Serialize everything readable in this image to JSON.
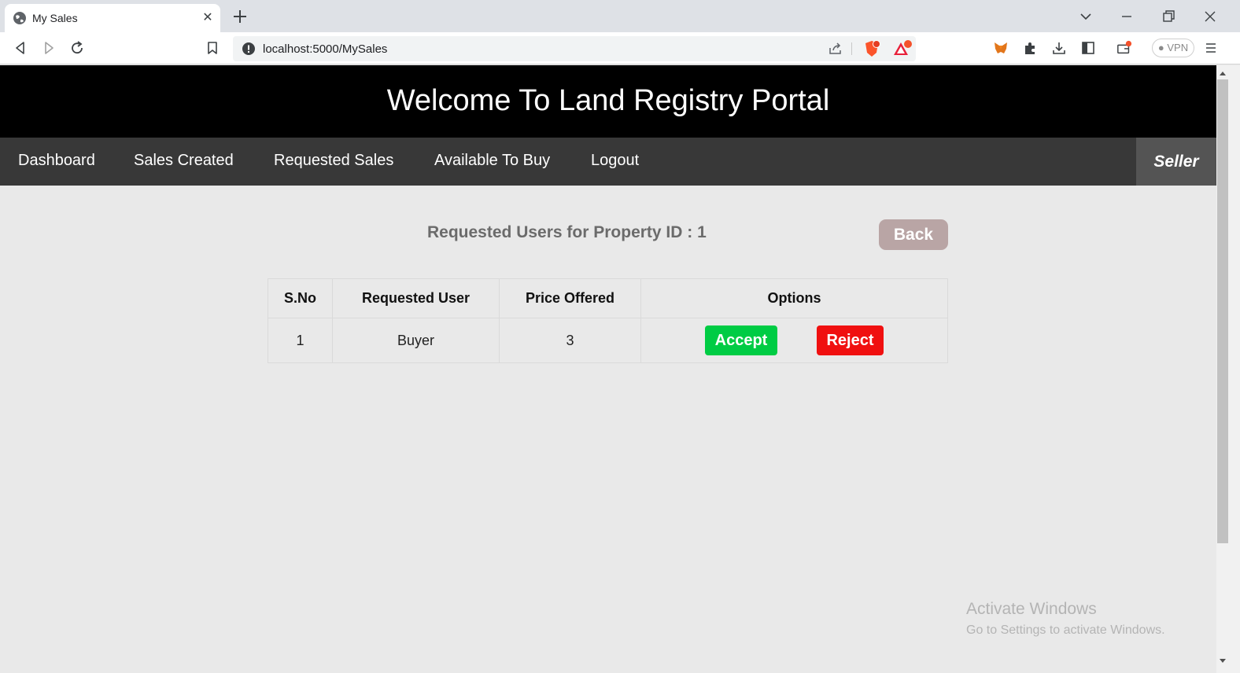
{
  "browser": {
    "tab_title": "My Sales",
    "tab_close": "✕",
    "url": "localhost:5000/MySales",
    "vpn_label": "● VPN"
  },
  "header": {
    "title": "Welcome To Land Registry Portal"
  },
  "nav": {
    "items": [
      "Dashboard",
      "Sales Created",
      "Requested Sales",
      "Available To Buy",
      "Logout"
    ],
    "role": "Seller"
  },
  "main": {
    "heading": "Requested Users for Property ID : 1",
    "back_label": "Back",
    "table": {
      "headers": [
        "S.No",
        "Requested User",
        "Price Offered",
        "Options"
      ],
      "rows": [
        {
          "sno": "1",
          "user": "Buyer",
          "price": "3",
          "accept_label": "Accept",
          "reject_label": "Reject"
        }
      ]
    }
  },
  "watermark": {
    "title": "Activate Windows",
    "subtitle": "Go to Settings to activate Windows."
  },
  "colors": {
    "header_bg": "#000000",
    "nav_bg": "#383838",
    "accept": "#00cc44",
    "reject": "#f01010",
    "back": "#b9a5a5"
  }
}
